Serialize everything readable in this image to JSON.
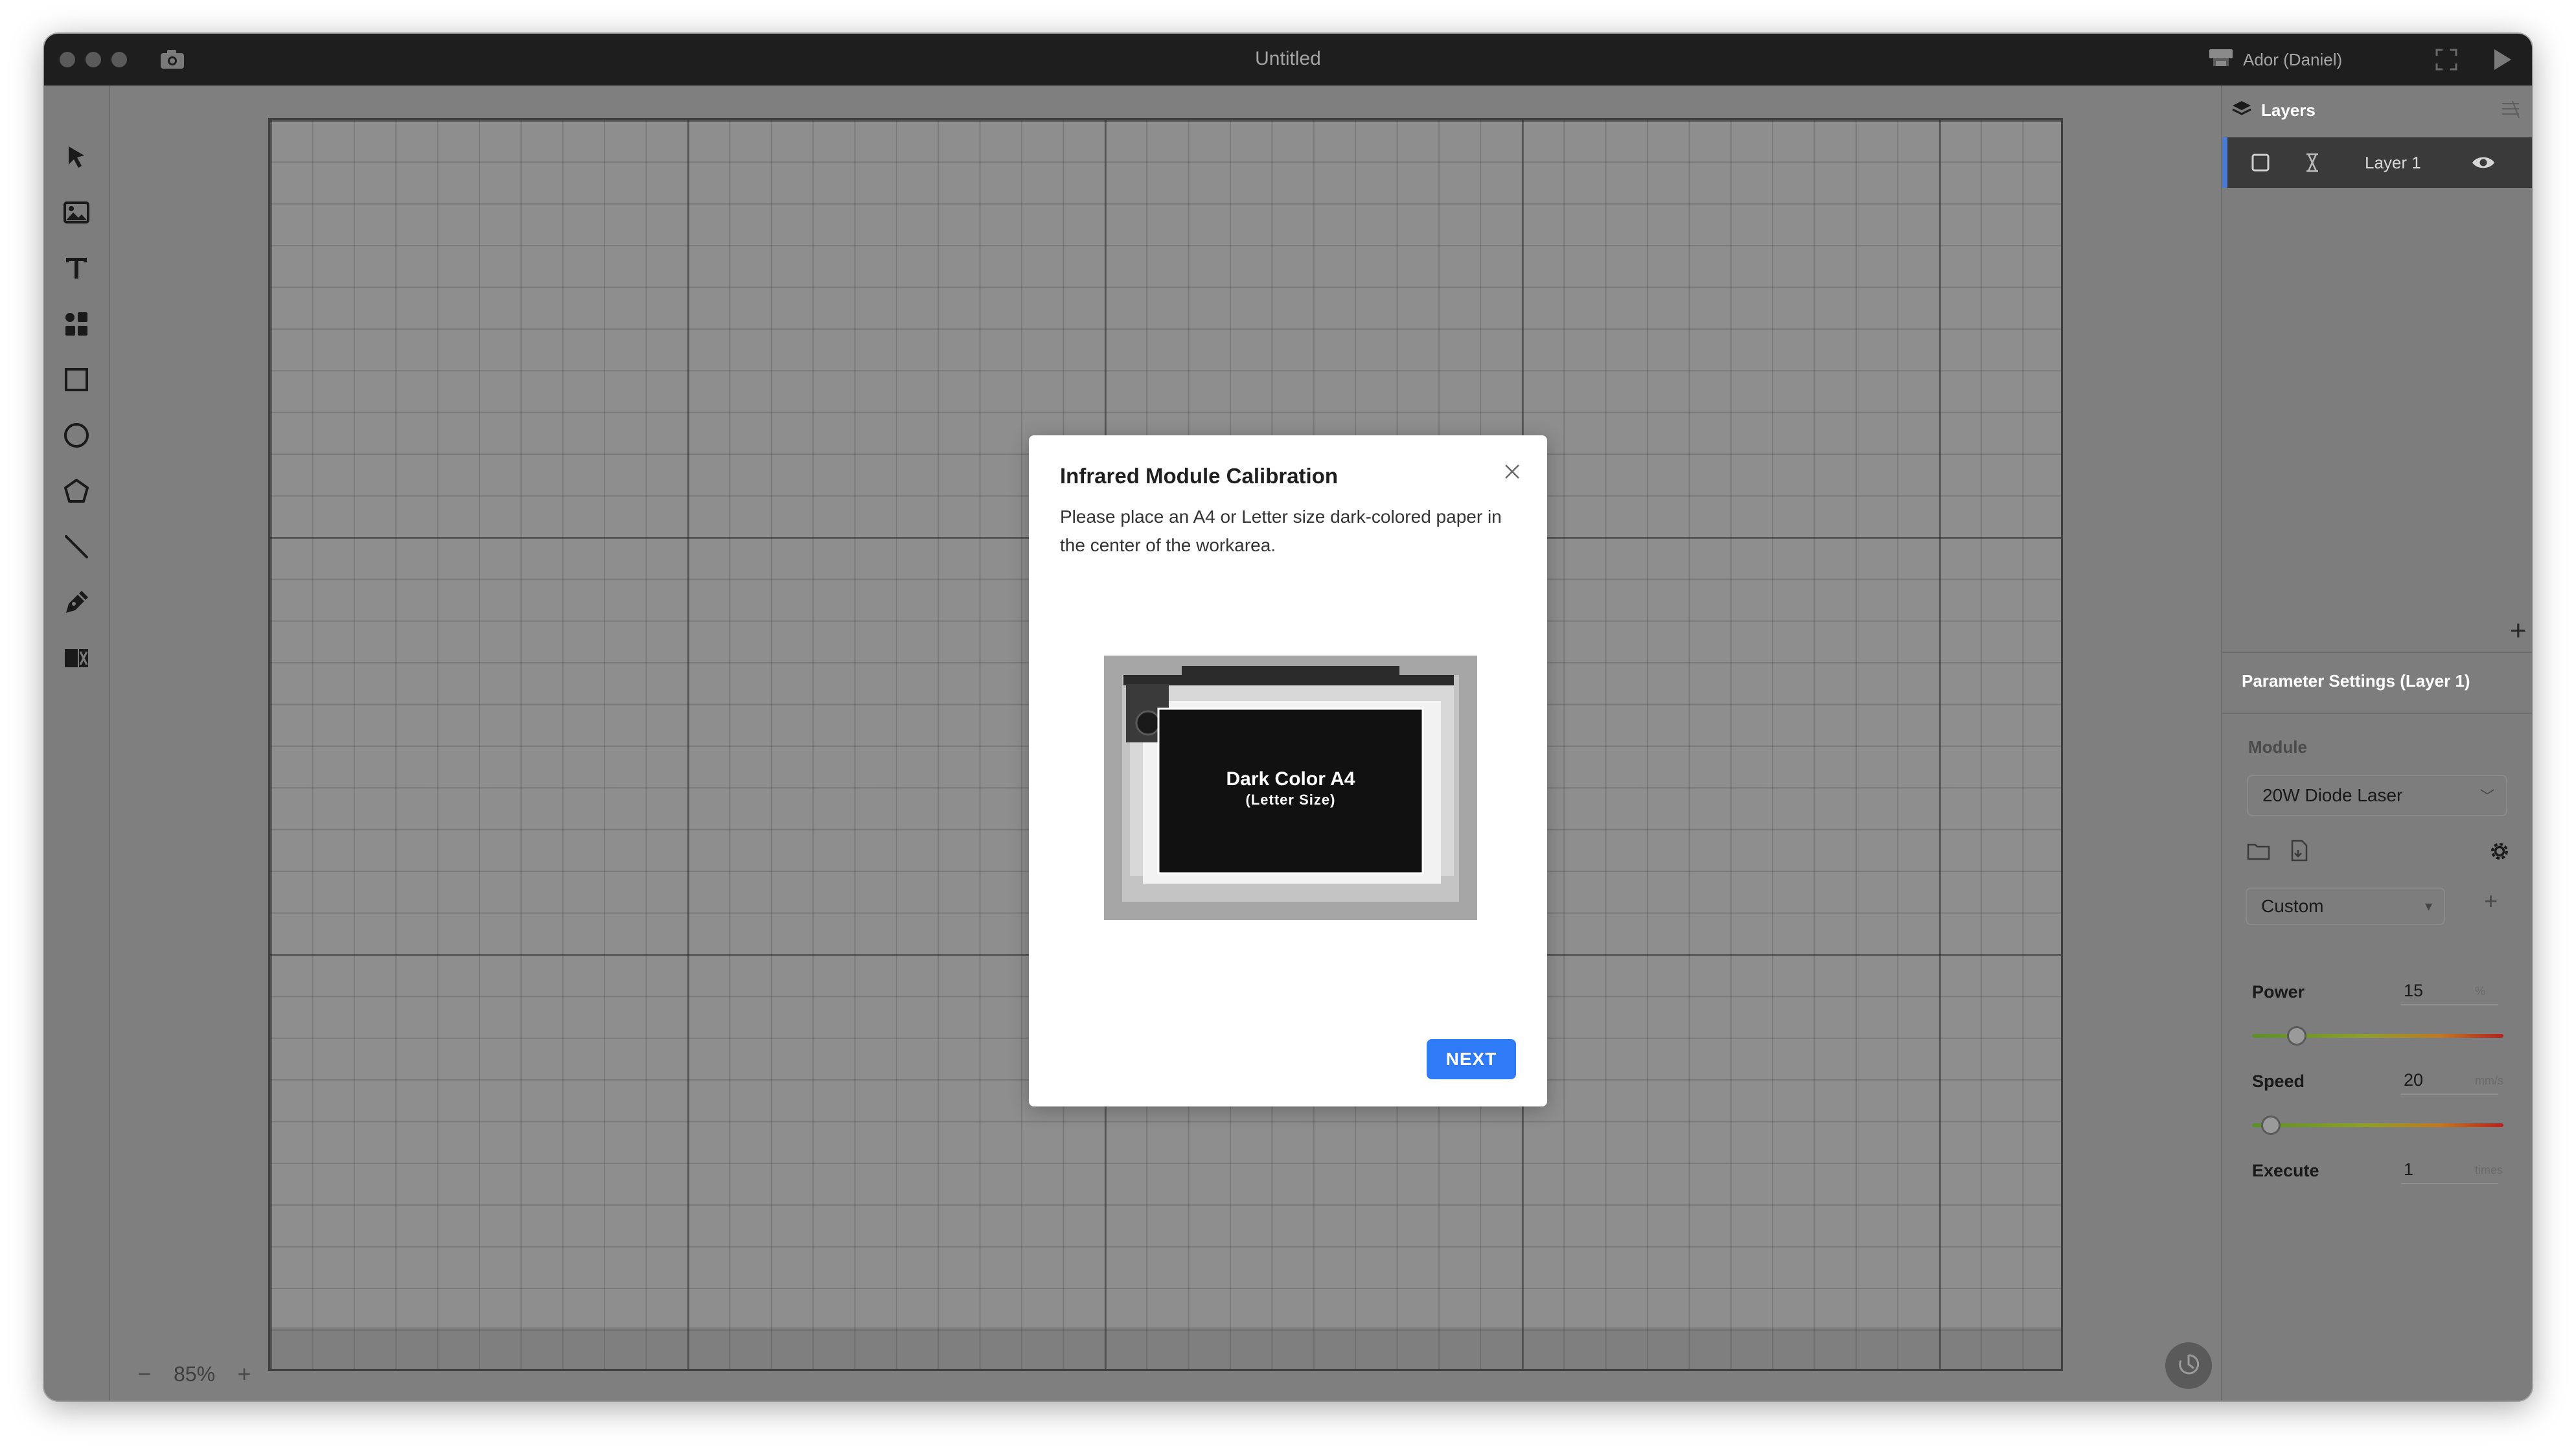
{
  "window": {
    "title": "Untitled"
  },
  "titlebar": {
    "device_label": "Ador (Daniel)",
    "icons": [
      "camera-icon",
      "device-icon",
      "fullscreen-icon",
      "play-icon"
    ]
  },
  "toolbar": {
    "tools": [
      "cursor-icon",
      "image-icon",
      "text-icon",
      "elements-icon",
      "rectangle-icon",
      "ellipse-icon",
      "polygon-icon",
      "line-icon",
      "pen-icon",
      "dmkt-icon"
    ]
  },
  "zoom": {
    "minus": "−",
    "value": "85%",
    "plus": "+"
  },
  "layers": {
    "title": "Layers",
    "items": [
      {
        "name": "Layer 1",
        "visible": true
      }
    ],
    "add_label": "+"
  },
  "params": {
    "title": "Parameter Settings (Layer 1)",
    "module_label": "Module",
    "module_value": "20W Diode Laser",
    "preset_value": "Custom",
    "add_preset_label": "+",
    "power": {
      "label": "Power",
      "value": "15",
      "unit": "%",
      "level": 0.15
    },
    "speed": {
      "label": "Speed",
      "value": "20",
      "unit": "mm/s",
      "level": 0.04
    },
    "execute": {
      "label": "Execute",
      "value": "1",
      "unit": "times"
    }
  },
  "modal": {
    "title": "Infrared Module Calibration",
    "description": "Please place an A4 or Letter size dark-colored paper in the center of the workarea.",
    "illustration": {
      "line1": "Dark Color A4",
      "line2": "(Letter Size)"
    },
    "next_label": "NEXT"
  },
  "colors": {
    "accent": "#2f7af7",
    "titlebar": "#1e1e1e",
    "canvas": "#8e8e8e"
  }
}
